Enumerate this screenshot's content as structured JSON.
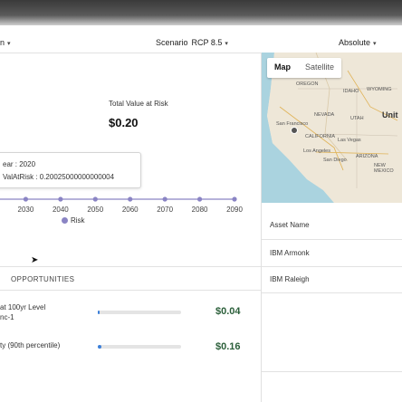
{
  "topbar": {
    "text": ""
  },
  "controls": {
    "left_select_value": "n",
    "scenario_label": "Scenario",
    "scenario_value": "RCP 8.5",
    "mode_value": "Absolute",
    "caret_glyph": "▾"
  },
  "summary": {
    "label": "Total Value at Risk",
    "value": "$0.20"
  },
  "tooltip": {
    "year_line": "ear : 2020",
    "value_line": "ValAtRisk : 0.20025000000000004"
  },
  "chart_data": {
    "type": "line",
    "x": [
      2020,
      2030,
      2040,
      2050,
      2060,
      2070,
      2080,
      2090
    ],
    "series": [
      {
        "name": "Risk",
        "values": [
          0.2,
          0.2,
          0.2,
          0.2,
          0.2,
          0.2,
          0.2,
          0.2
        ],
        "color": "#8a84c4"
      }
    ],
    "tick_labels": [
      "2030",
      "2040",
      "2050",
      "2060",
      "2070",
      "2080",
      "2090"
    ],
    "legend_label": "Risk"
  },
  "opportunities": {
    "heading": "OPPORTUNITIES",
    "items": [
      {
        "line1": "at 100yr Level",
        "line2": "nc-1",
        "fill_fraction": 0.02,
        "value": "$0.04"
      },
      {
        "line1": "ty (90th percentile)",
        "line2": "",
        "fill_fraction": 0.04,
        "value": "$0.16"
      }
    ]
  },
  "map": {
    "tab_map": "Map",
    "tab_satellite": "Satellite",
    "labels": [
      {
        "text": "OREGON"
      },
      {
        "text": "IDAHO"
      },
      {
        "text": "WYOMING"
      },
      {
        "text": "NEVADA"
      },
      {
        "text": "UTAH"
      },
      {
        "text": "Unit"
      },
      {
        "text": "San Francisco"
      },
      {
        "text": "CALIFORNIA"
      },
      {
        "text": "Las Vegas"
      },
      {
        "text": "Los Angeles"
      },
      {
        "text": "San Diego"
      },
      {
        "text": "ARIZONA"
      },
      {
        "text": "NEW MEXICO"
      }
    ]
  },
  "assets": {
    "header": "Asset Name",
    "rows": [
      "IBM Armonk",
      "IBM Raleigh"
    ]
  },
  "colors": {
    "accent": "#3b7fd9",
    "risk_series": "#8a84c4",
    "value_green": "#2b5f3a"
  }
}
